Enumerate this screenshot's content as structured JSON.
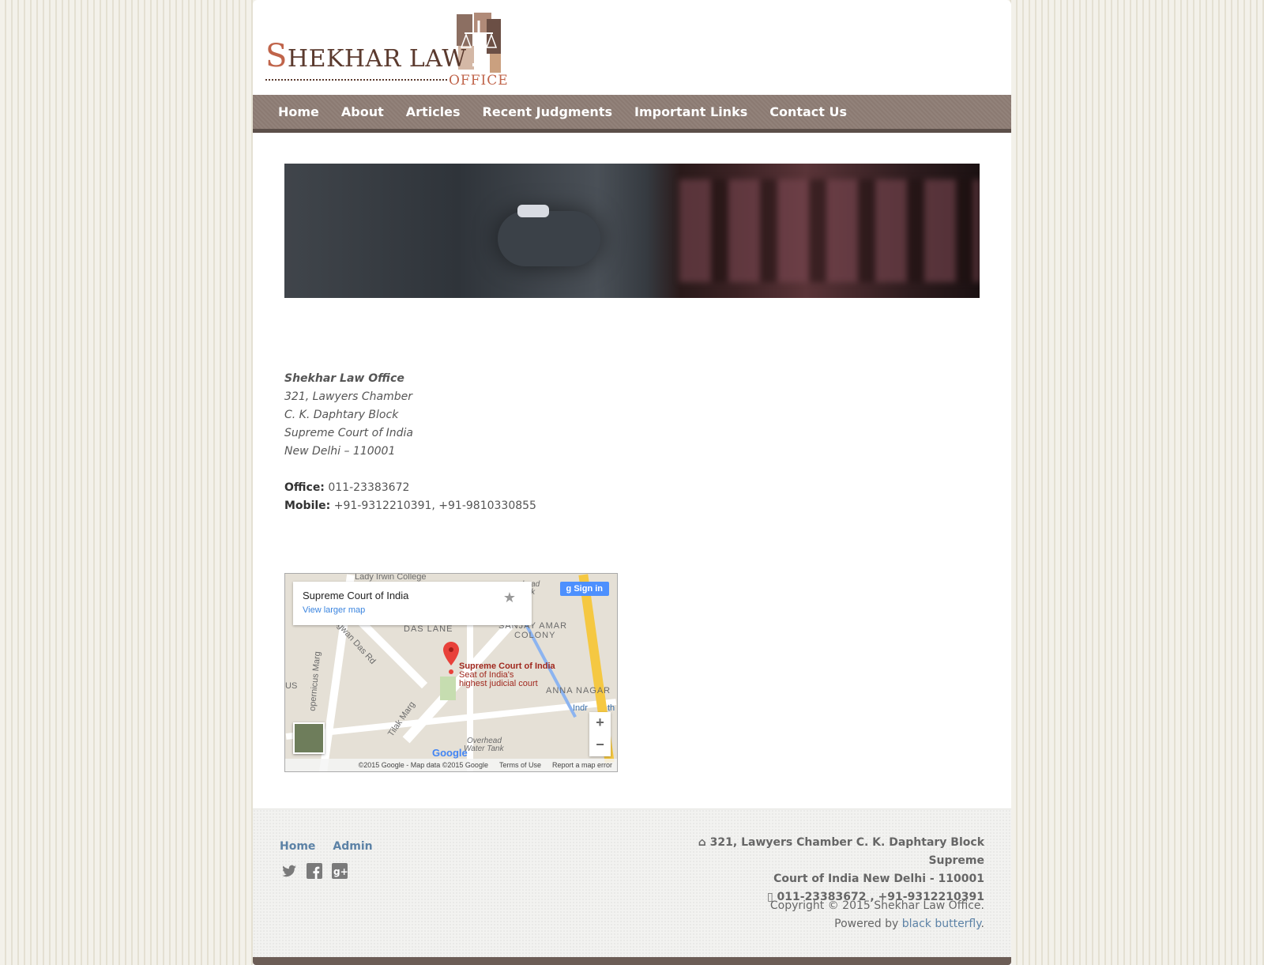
{
  "logo": {
    "main_initial": "S",
    "main_rest": "HEKHAR LAW",
    "sub": "OFFICE"
  },
  "nav": {
    "items": [
      "Home",
      "About",
      "Articles",
      "Recent Judgments",
      "Important Links",
      "Contact Us"
    ]
  },
  "address": {
    "name": "Shekhar Law Office",
    "lines": [
      "321, Lawyers Chamber",
      "C. K. Daphtary Block",
      "Supreme Court of India",
      "New Delhi – 110001"
    ]
  },
  "contacts": {
    "office_label": "Office:",
    "office_value": "011-23383672",
    "mobile_label": "Mobile:",
    "mobile_value": "+91-9312210391, +91-9810330855"
  },
  "map": {
    "place_title": "Supreme Court of India",
    "view_larger": "View larger map",
    "signin": "Sign in",
    "pin_title": "Supreme Court of India",
    "pin_desc_1": "Seat of India's",
    "pin_desc_2": "highest judicial court",
    "labels": [
      "Lady Irwin College",
      "DAS LANE",
      "SANJAY AMAR",
      "COLONY",
      "ANNA NAGAR",
      "Tilak Marg",
      "opernicus Marg",
      "agwan Das Rd",
      "Overhead",
      "Water Tank",
      "Indr",
      "th",
      "US",
      "head",
      "ank"
    ],
    "google": "Google",
    "footer_attrib": "©2015 Google - Map data ©2015 Google",
    "footer_terms": "Terms of Use",
    "footer_report": "Report a map error"
  },
  "footer": {
    "links": [
      "Home",
      "Admin"
    ],
    "social_icons": [
      "twitter-icon",
      "facebook-icon",
      "google-plus-icon"
    ],
    "address_line_1": "321, Lawyers Chamber C. K. Daphtary Block Supreme",
    "address_line_2": "Court of India New Delhi - 110001",
    "phone": "011-23383672 , +91-9312210391",
    "copyright": "Copyright © 2015 Shekhar Law Office.",
    "powered_prefix": "Powered by ",
    "powered_link": "black butterfly",
    "powered_suffix": "."
  },
  "colors": {
    "nav_bg": "#8b7a72",
    "link": "#5c82a6",
    "logo_accent": "#c0644a"
  }
}
